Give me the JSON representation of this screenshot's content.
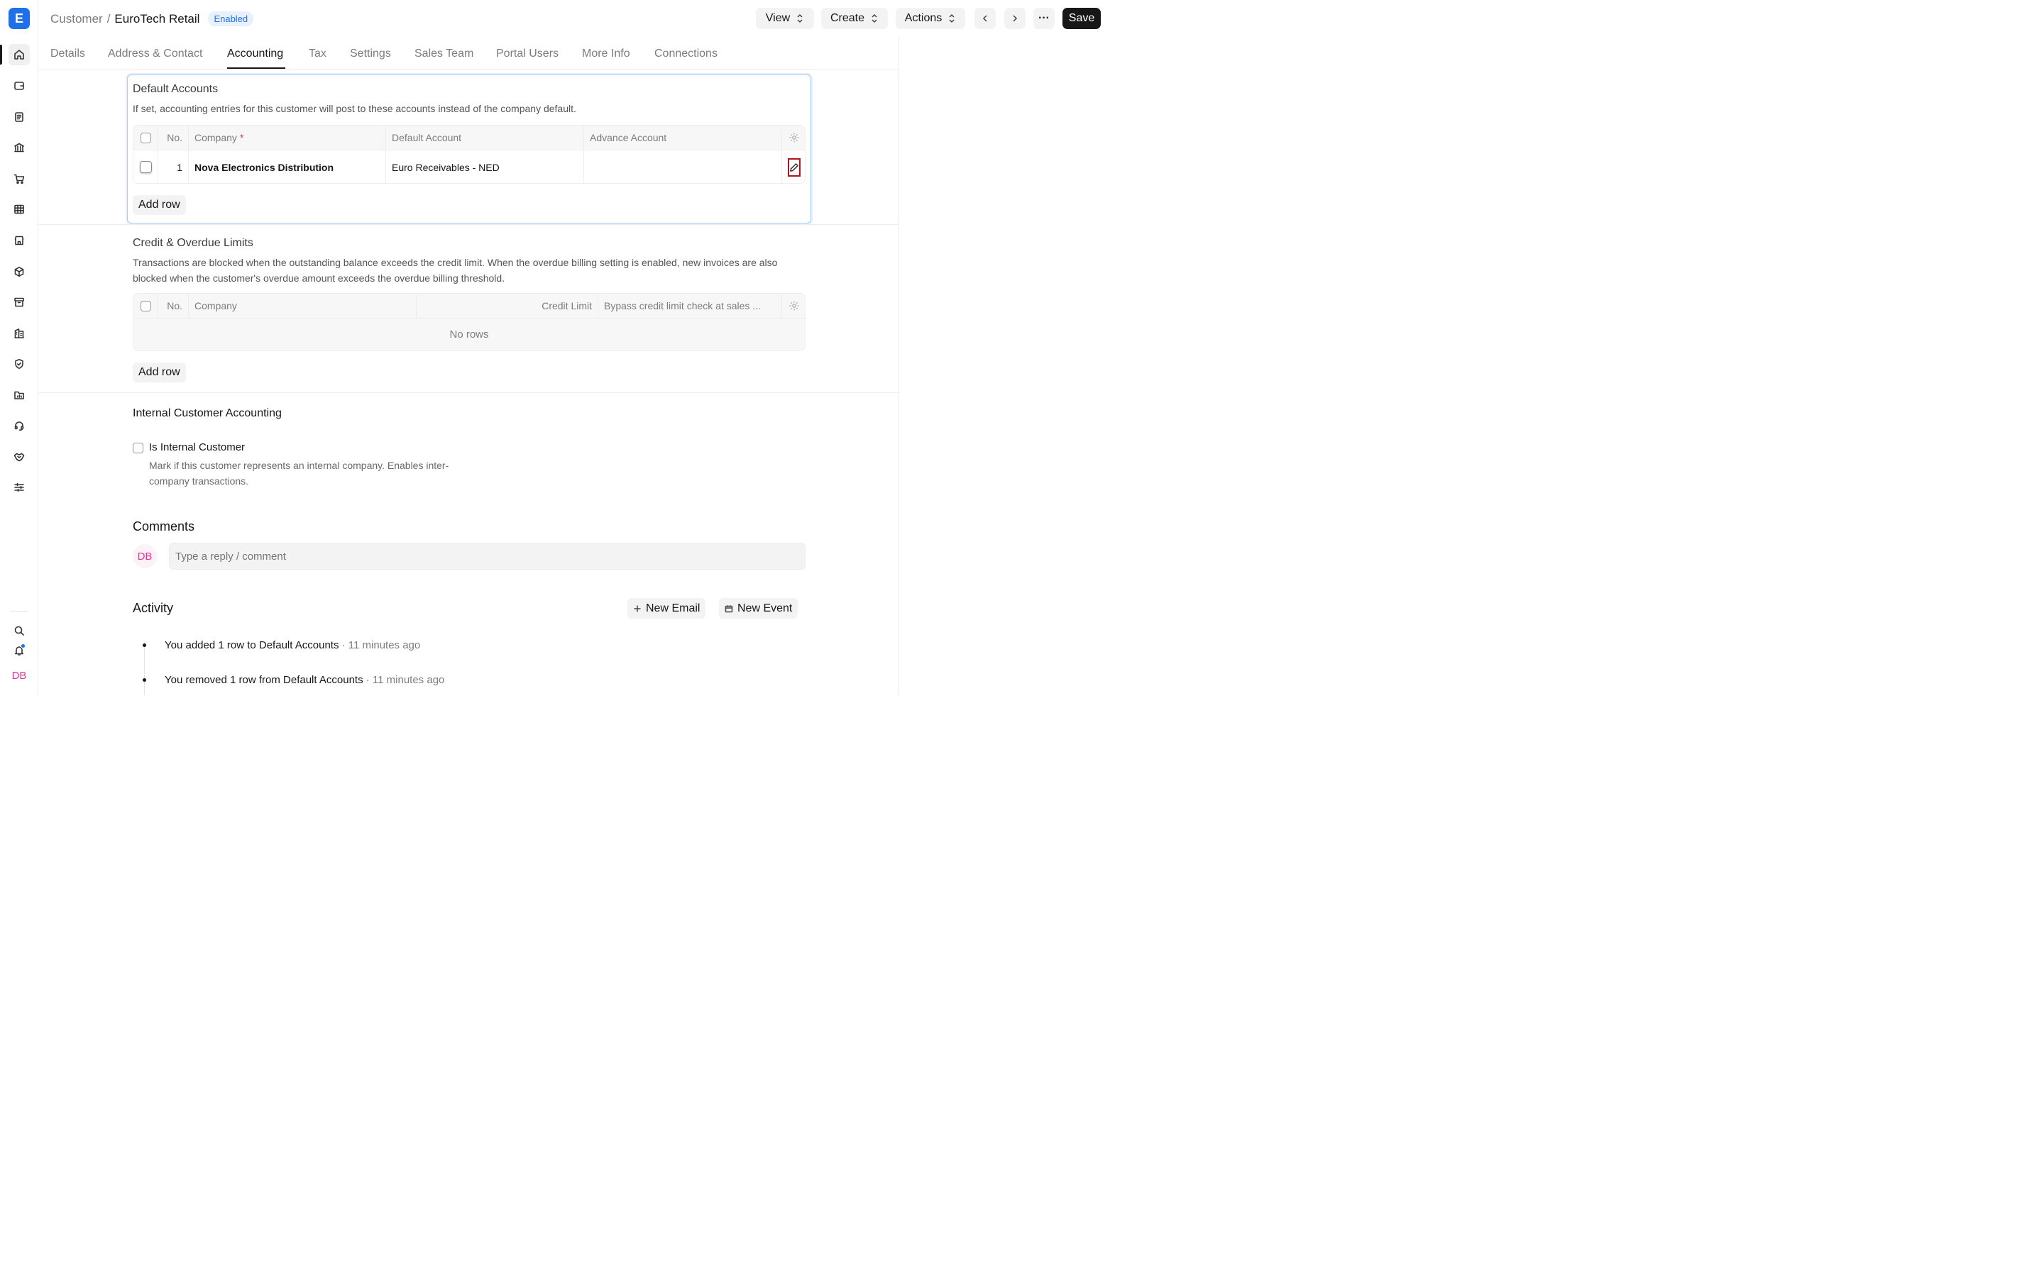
{
  "app": {
    "logo_letter": "E"
  },
  "breadcrumb": {
    "parent": "Customer",
    "separator": "/",
    "current": "EuroTech Retail",
    "status": "Enabled"
  },
  "header": {
    "view": "View",
    "create": "Create",
    "actions": "Actions",
    "more": "···",
    "save": "Save"
  },
  "tabs": [
    "Details",
    "Address & Contact",
    "Accounting",
    "Tax",
    "Settings",
    "Sales Team",
    "Portal Users",
    "More Info",
    "Connections"
  ],
  "active_tab": "Accounting",
  "sidebar": {
    "icons": [
      "home-icon",
      "wallet-icon",
      "document-icon",
      "bank-icon",
      "cart-icon",
      "table-icon",
      "store-icon",
      "box-icon",
      "archive-icon",
      "building-icon",
      "shield-icon",
      "folder-chart-icon",
      "headset-icon",
      "handshake-icon",
      "sliders-icon"
    ],
    "user_initials": "DB"
  },
  "default_accounts": {
    "title": "Default Accounts",
    "description": "If set, accounting entries for this customer will post to these accounts instead of the company default.",
    "columns": {
      "no": "No.",
      "company": "Company",
      "required_mark": "*",
      "default_account": "Default Account",
      "advance_account": "Advance Account"
    },
    "rows": [
      {
        "no": "1",
        "company": "Nova Electronics Distribution",
        "default_account": "Euro Receivables - NED",
        "advance_account": ""
      }
    ],
    "add_row": "Add row"
  },
  "credit_limits": {
    "title": "Credit & Overdue Limits",
    "description": "Transactions are blocked when the outstanding balance exceeds the credit limit. When the overdue billing setting is enabled, new invoices are also blocked when the customer's overdue amount exceeds the overdue billing threshold.",
    "columns": {
      "no": "No.",
      "company": "Company",
      "credit_limit": "Credit Limit",
      "bypass": "Bypass credit limit check at sales ..."
    },
    "empty": "No rows",
    "add_row": "Add row"
  },
  "internal": {
    "title": "Internal Customer Accounting",
    "checkbox_label": "Is Internal Customer",
    "help": "Mark if this customer represents an internal company. Enables inter-company transactions."
  },
  "comments": {
    "title": "Comments",
    "avatar": "DB",
    "placeholder": "Type a reply / comment"
  },
  "activity": {
    "title": "Activity",
    "new_email": "New Email",
    "new_event": "New Event",
    "items": [
      {
        "text": "You added 1 row to Default Accounts",
        "time": " · 11 minutes ago"
      },
      {
        "text": "You removed 1 row from Default Accounts",
        "time": " · 11 minutes ago"
      }
    ]
  },
  "colors": {
    "accent": "#1f6feb",
    "highlight": "#b3131b",
    "avatar": "#e0359a"
  }
}
